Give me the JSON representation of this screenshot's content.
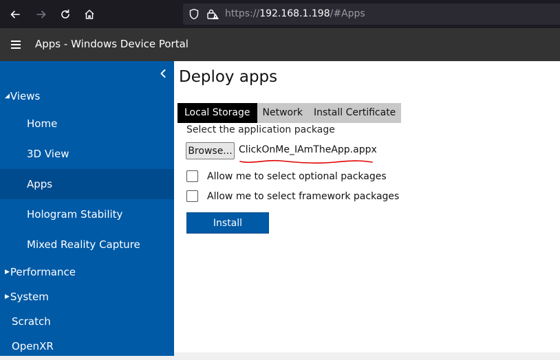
{
  "browser": {
    "back_icon": "arrow-left-icon",
    "forward_icon": "arrow-right-icon",
    "reload_icon": "reload-icon",
    "home_icon": "home-icon",
    "url_prefix": "https://",
    "url_host": "192.168.1.198",
    "url_path": "/#Apps"
  },
  "header": {
    "menu_icon": "hamburger-icon",
    "title": "Apps - Windows Device Portal"
  },
  "sidebar": {
    "collapse_icon": "chevron-left-icon",
    "views_label": "Views",
    "views_items": [
      {
        "label": "Home"
      },
      {
        "label": "3D View"
      },
      {
        "label": "Apps",
        "active": true
      },
      {
        "label": "Hologram Stability"
      },
      {
        "label": "Mixed Reality Capture"
      }
    ],
    "performance_label": "Performance",
    "system_label": "System",
    "scratch_label": "Scratch",
    "openxr_label": "OpenXR"
  },
  "main": {
    "title": "Deploy apps",
    "tabs": [
      {
        "label": "Local Storage",
        "active": true
      },
      {
        "label": "Network"
      },
      {
        "label": "Install Certificate"
      }
    ],
    "select_label": "Select the application package",
    "browse_label": "Browse...",
    "file_name": "ClickOnMe_IAmTheApp.appx",
    "optional_label": "Allow me to select optional packages",
    "framework_label": "Allow me to select framework packages",
    "install_label": "Install"
  },
  "colors": {
    "sidebar_bg": "#005aa6",
    "sidebar_active": "#004b8e",
    "title_bar": "#333333",
    "browser_bar": "#1c1b22",
    "annotation_red": "#e00000"
  }
}
